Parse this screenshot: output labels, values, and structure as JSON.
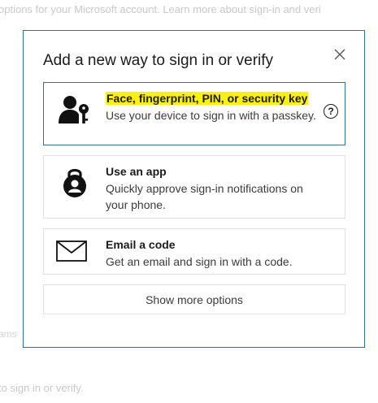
{
  "background": {
    "top_text": "options for your Microsoft account. Learn more about sign-in and veri",
    "bottom_text": "to sign in or verify.",
    "left_fragment": "ams"
  },
  "dialog": {
    "title": "Add a new way to sign in or verify",
    "close_icon": "close-icon",
    "options": [
      {
        "title": "Face, fingerprint, PIN, or security key",
        "description": "Use your device to sign in with a passkey.",
        "icon": "person-key-icon",
        "selected": true,
        "help": "?"
      },
      {
        "title": "Use an app",
        "description": "Quickly approve sign-in notifications on your phone.",
        "icon": "authenticator-lock-icon"
      },
      {
        "title": "Email a code",
        "description": "Get an email and sign in with a code.",
        "icon": "envelope-icon"
      }
    ],
    "more_label": "Show more options"
  },
  "colors": {
    "border_accent": "#2b6ea6",
    "highlight": "#fff200"
  }
}
